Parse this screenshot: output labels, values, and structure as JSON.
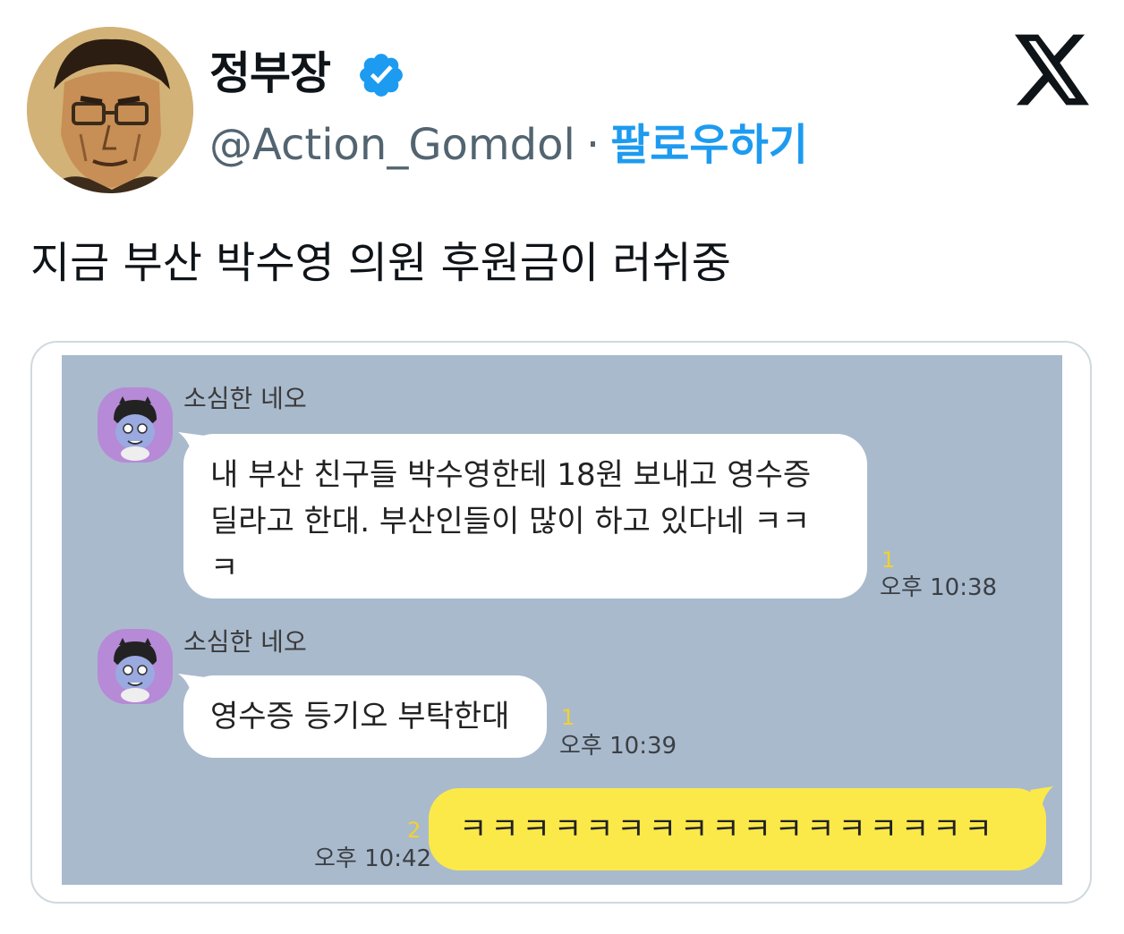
{
  "tweet": {
    "author": {
      "display_name": "정부장",
      "handle": "@Action_Gomdol",
      "verified": true,
      "avatar_icon": "cartoon-man-portrait"
    },
    "separator": "·",
    "follow_label": "팔로우하기",
    "platform_icon": "x-logo-icon",
    "text": "지금 부산 박수영 의원 후원금이 러쉬중"
  },
  "chat": {
    "background_color": "#a9bacd",
    "messages": [
      {
        "sender": "소심한 네오",
        "lines": [
          "내 부산 친구들 박수영한테 18원 보내고 영수증",
          "딜라고 한대. 부산인들이 많이 하고 있다네 ㅋㅋ",
          "ㅋ"
        ],
        "unread": "1",
        "time": "오후 10:38"
      },
      {
        "sender": "소심한 네오",
        "lines": [
          "영수증 등기오 부탁한대"
        ],
        "unread": "1",
        "time": "오후 10:39"
      },
      {
        "sender": "",
        "lines": [
          "ㅋㅋㅋㅋㅋㅋㅋㅋㅋㅋㅋㅋㅋㅋㅋㅋㅋ"
        ],
        "unread": "2",
        "time": "오후 10:42",
        "mine": true
      }
    ]
  },
  "colors": {
    "accent": "#1d9bf0",
    "secondary_text": "#536471",
    "my_bubble": "#fbe94a",
    "unread_count": "#f2d22b"
  }
}
